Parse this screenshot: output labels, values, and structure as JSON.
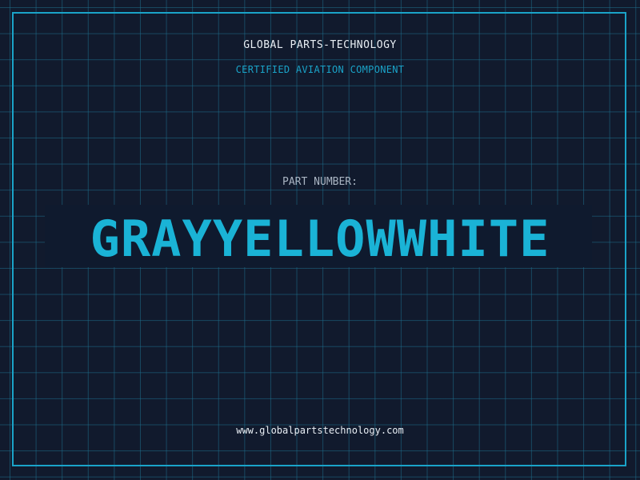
{
  "header": {
    "brand": "GLOBAL PARTS-TECHNOLOGY",
    "subtitle": "CERTIFIED AVIATION COMPONENT"
  },
  "main": {
    "label": "PART NUMBER:",
    "part_number": "GRAYYELLOWWHITE"
  },
  "footer": {
    "url": "www.globalpartstechnology.com"
  },
  "colors": {
    "background": "#111a2d",
    "grid": "#1d6e8c",
    "accent": "#1ab3d6",
    "frame": "#1aa3c8"
  }
}
